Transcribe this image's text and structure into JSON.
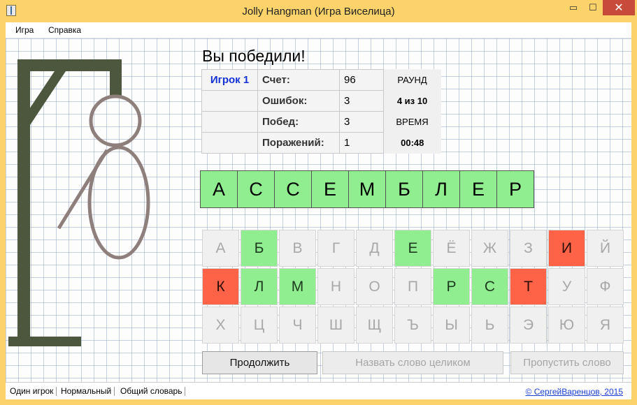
{
  "window": {
    "title": "Jolly Hangman (Игра Виселица)",
    "min_glyph": "▭",
    "max_glyph": "☐",
    "close_glyph": "✕"
  },
  "menu": [
    "Игра",
    "Справка"
  ],
  "game": {
    "message": "Вы победили!",
    "player": "Игрок 1",
    "stats": [
      {
        "label": "Счет:",
        "value": "96"
      },
      {
        "label": "Ошибок:",
        "value": "3"
      },
      {
        "label": "Побед:",
        "value": "3"
      },
      {
        "label": "Поражений:",
        "value": "1"
      }
    ],
    "round_label": "РАУНД",
    "round_value": "4 из 10",
    "time_label": "ВРЕМЯ",
    "time_value": "00:48",
    "word": [
      "А",
      "С",
      "С",
      "Е",
      "М",
      "Б",
      "Л",
      "Е",
      "Р"
    ],
    "keyboard": [
      {
        "l": "А",
        "s": "unused"
      },
      {
        "l": "Б",
        "s": "correct"
      },
      {
        "l": "В",
        "s": "unused"
      },
      {
        "l": "Г",
        "s": "unused"
      },
      {
        "l": "Д",
        "s": "unused"
      },
      {
        "l": "Е",
        "s": "correct"
      },
      {
        "l": "Ё",
        "s": "unused"
      },
      {
        "l": "Ж",
        "s": "unused"
      },
      {
        "l": "З",
        "s": "unused"
      },
      {
        "l": "И",
        "s": "wrong"
      },
      {
        "l": "Й",
        "s": "unused"
      },
      {
        "l": "К",
        "s": "wrong"
      },
      {
        "l": "Л",
        "s": "correct"
      },
      {
        "l": "М",
        "s": "correct"
      },
      {
        "l": "Н",
        "s": "unused"
      },
      {
        "l": "О",
        "s": "unused"
      },
      {
        "l": "П",
        "s": "unused"
      },
      {
        "l": "Р",
        "s": "correct"
      },
      {
        "l": "С",
        "s": "correct"
      },
      {
        "l": "Т",
        "s": "wrong"
      },
      {
        "l": "У",
        "s": "unused"
      },
      {
        "l": "Ф",
        "s": "unused"
      },
      {
        "l": "Х",
        "s": "unused"
      },
      {
        "l": "Ц",
        "s": "unused"
      },
      {
        "l": "Ч",
        "s": "unused"
      },
      {
        "l": "Ш",
        "s": "unused"
      },
      {
        "l": "Щ",
        "s": "unused"
      },
      {
        "l": "Ъ",
        "s": "unused"
      },
      {
        "l": "Ы",
        "s": "unused"
      },
      {
        "l": "Ь",
        "s": "unused"
      },
      {
        "l": "Э",
        "s": "unused"
      },
      {
        "l": "Ю",
        "s": "unused"
      },
      {
        "l": "Я",
        "s": "unused"
      }
    ],
    "buttons": {
      "continue": "Продолжить",
      "guess_word": "Назвать слово целиком",
      "skip_word": "Пропустить слово"
    }
  },
  "status": {
    "mode": "Один игрок",
    "difficulty": "Нормальный",
    "dictionary": "Общий словарь",
    "copyright": "© СергейВаренцов, 2015"
  },
  "colors": {
    "correct": "#90ee90",
    "wrong": "#ff6347",
    "gallows": "#4c573e",
    "figure": "#8f7f7c",
    "player": "#1432d8"
  }
}
